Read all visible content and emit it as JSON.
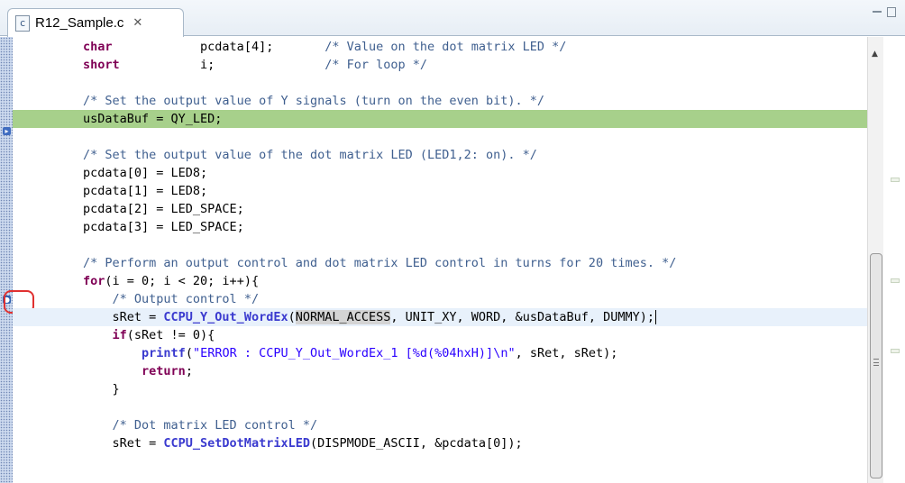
{
  "tab": {
    "label": "R12_Sample.c",
    "icon": "c-file-icon",
    "close": "✕"
  },
  "code_lines": [
    {
      "row": 0,
      "segs": [
        [
          "kw",
          "char"
        ],
        [
          "",
          "            pcdata[4];       "
        ],
        [
          "cm",
          "/* Value on the dot matrix LED */"
        ]
      ]
    },
    {
      "row": 1,
      "segs": [
        [
          "kw",
          "short"
        ],
        [
          "",
          "           i;               "
        ],
        [
          "cm",
          "/* For loop */"
        ]
      ]
    },
    {
      "row": 3,
      "segs": [
        [
          "cm",
          "/* Set the output value of Y signals (turn on the even bit). */"
        ]
      ]
    },
    {
      "row": 4,
      "segs": [
        [
          "",
          "usDataBuf = QY_LED;"
        ]
      ],
      "cls": "pc-line"
    },
    {
      "row": 6,
      "segs": [
        [
          "cm",
          "/* Set the output value of the dot matrix LED (LED1,2: on). */"
        ]
      ]
    },
    {
      "row": 7,
      "segs": [
        [
          "",
          "pcdata[0] = LED8;"
        ]
      ]
    },
    {
      "row": 8,
      "segs": [
        [
          "",
          "pcdata[1] = LED8;"
        ]
      ]
    },
    {
      "row": 9,
      "segs": [
        [
          "",
          "pcdata[2] = LED_SPACE;"
        ]
      ]
    },
    {
      "row": 10,
      "segs": [
        [
          "",
          "pcdata[3] = LED_SPACE;"
        ]
      ]
    },
    {
      "row": 12,
      "segs": [
        [
          "cm",
          "/* Perform an output control and dot matrix LED control in turns for 20 times. */"
        ]
      ]
    },
    {
      "row": 13,
      "segs": [
        [
          "kw",
          "for"
        ],
        [
          "",
          "(i = 0; i < 20; i++){"
        ]
      ]
    },
    {
      "row": 14,
      "segs": [
        [
          "",
          "    "
        ],
        [
          "cm",
          "/* Output control */"
        ]
      ]
    },
    {
      "row": 15,
      "segs": [
        [
          "",
          "    sRet = "
        ],
        [
          "fn",
          "CCPU_Y_Out_WordEx"
        ],
        [
          "",
          "("
        ],
        [
          "mark",
          "NORMAL_ACCESS"
        ],
        [
          "",
          ", UNIT_XY, WORD, &usDataBuf, DUMMY);"
        ],
        [
          "caret",
          ""
        ]
      ],
      "cls": "cursor-line"
    },
    {
      "row": 16,
      "segs": [
        [
          "",
          "    "
        ],
        [
          "kw",
          "if"
        ],
        [
          "",
          "(sRet != 0){"
        ]
      ]
    },
    {
      "row": 17,
      "segs": [
        [
          "",
          "        "
        ],
        [
          "fn",
          "printf"
        ],
        [
          "",
          "("
        ],
        [
          "str",
          "\"ERROR : CCPU_Y_Out_WordEx_1 [%d(%04hxH)]\\n\""
        ],
        [
          "",
          ", sRet, sRet);"
        ]
      ]
    },
    {
      "row": 18,
      "segs": [
        [
          "",
          "        "
        ],
        [
          "kw",
          "return"
        ],
        [
          "",
          ";"
        ]
      ]
    },
    {
      "row": 19,
      "segs": [
        [
          "",
          "    }"
        ]
      ]
    },
    {
      "row": 21,
      "segs": [
        [
          "",
          "    "
        ],
        [
          "cm",
          "/* Dot matrix LED control */"
        ]
      ]
    },
    {
      "row": 22,
      "segs": [
        [
          "",
          "    sRet = "
        ],
        [
          "fn",
          "CCPU_SetDotMatrixLED"
        ],
        [
          "",
          "(DISPMODE_ASCII, &pcdata[0]);"
        ]
      ]
    }
  ],
  "ruler": {
    "pc_marker": "program-counter-icon",
    "bp_marker": "breakpoint-icon"
  },
  "colors": {
    "keyword": "#7f0055",
    "comment": "#3f5f8f",
    "function": "#3a3acf",
    "string": "#2a00ff",
    "pc_line": "#a7d08b",
    "cursor_line": "#e8f1fb",
    "highlight_box": "#e03030"
  }
}
